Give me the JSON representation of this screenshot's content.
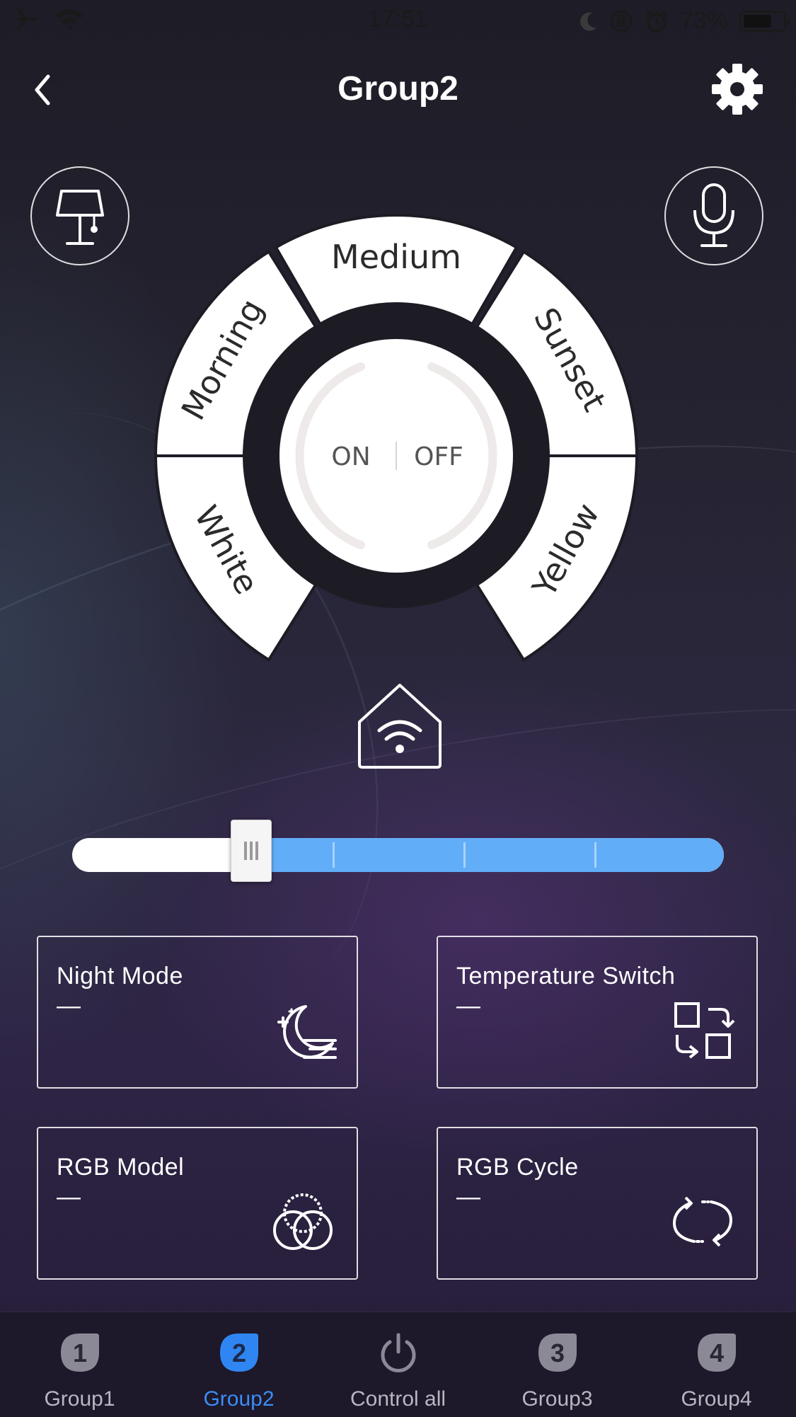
{
  "status_bar": {
    "time": "17:51",
    "battery_percent": "73%",
    "battery_level": 0.73
  },
  "header": {
    "title": "Group2"
  },
  "dial": {
    "scenes": [
      "Morning",
      "Medium",
      "Sunset",
      "White",
      "Yellow"
    ],
    "on_label": "ON",
    "off_label": "OFF"
  },
  "brightness": {
    "level": 0.27
  },
  "cards": {
    "night_mode": {
      "title": "Night Mode",
      "value": "—"
    },
    "temperature_switch": {
      "title": "Temperature Switch",
      "value": "—"
    },
    "rgb_model": {
      "title": "RGB Model",
      "value": "—"
    },
    "rgb_cycle": {
      "title": "RGB Cycle",
      "value": "—"
    }
  },
  "tabs": [
    {
      "label": "Group1",
      "badge": "1",
      "active": false
    },
    {
      "label": "Group2",
      "badge": "2",
      "active": true
    },
    {
      "label": "Control all",
      "badge": "",
      "active": false
    },
    {
      "label": "Group3",
      "badge": "3",
      "active": false
    },
    {
      "label": "Group4",
      "badge": "4",
      "active": false
    }
  ],
  "colors": {
    "accent": "#3c8cf5",
    "slider_fill": "#62adf7",
    "background_top": "#1e1c26",
    "background_bottom": "#251d38"
  },
  "icons": {
    "airplane": "airplane-icon",
    "wifi": "wifi-icon",
    "moon": "do-not-disturb-icon",
    "rotation_lock": "rotation-lock-icon",
    "alarm": "alarm-icon",
    "back": "chevron-left-icon",
    "settings": "gear-icon",
    "lamp": "lamp-icon",
    "mic": "microphone-icon",
    "home_wifi": "home-wifi-icon",
    "night": "moon-stars-icon",
    "temperature": "swap-icon",
    "rgb": "rgb-circles-icon",
    "cycle": "cycle-icon",
    "control_all": "power-icon"
  }
}
